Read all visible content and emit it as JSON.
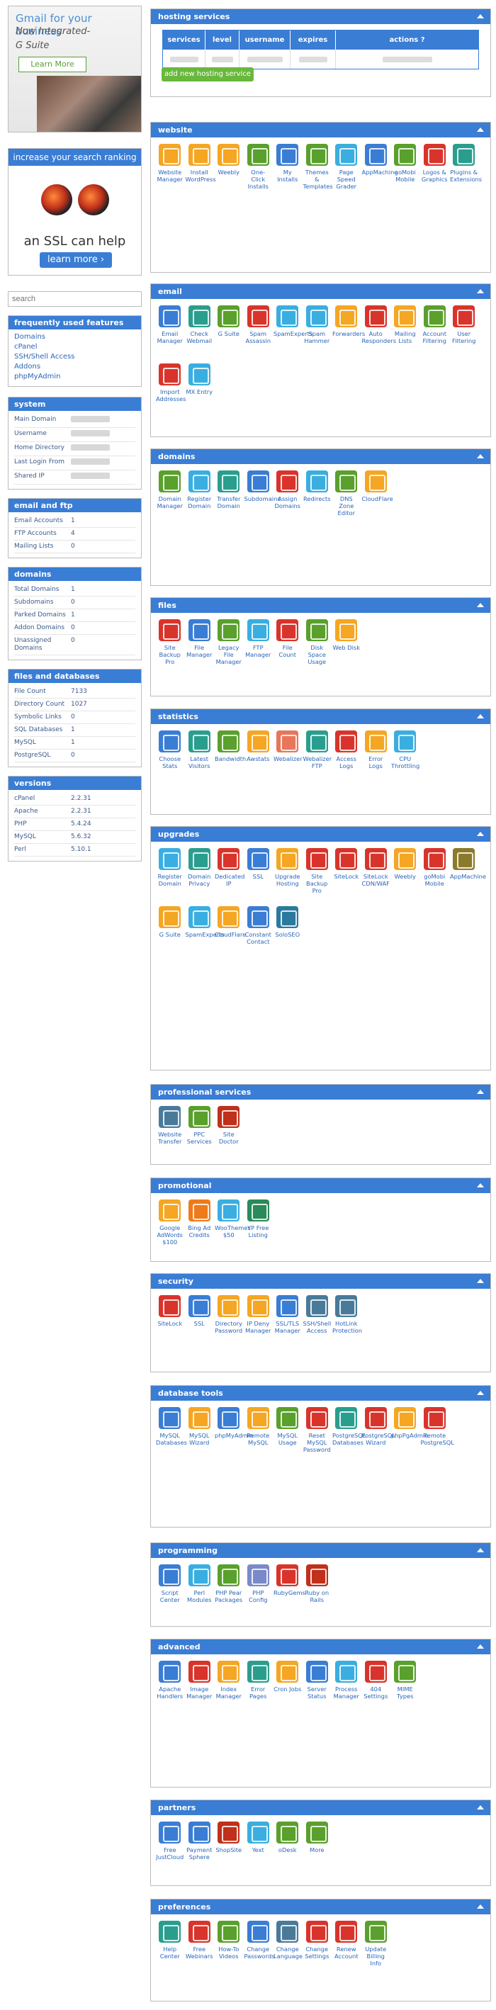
{
  "ads": {
    "gsuite": {
      "line1": "Gmail for your business",
      "line2": "Now Integrated-",
      "line3": "G Suite",
      "button": "Learn More"
    },
    "ssl": {
      "header": "increase your search ranking",
      "text": "an SSL can help",
      "button": "learn more  ›"
    }
  },
  "search_placeholder": "search",
  "features": {
    "title": "frequently used features",
    "links": [
      "Domains",
      "cPanel",
      "SSH/Shell Access",
      "Addons",
      "phpMyAdmin"
    ]
  },
  "system": {
    "title": "system",
    "rows": [
      {
        "k": "Main Domain"
      },
      {
        "k": "Username"
      },
      {
        "k": "Home Directory"
      },
      {
        "k": "Last Login From"
      },
      {
        "k": "Shared IP"
      }
    ]
  },
  "email_ftp": {
    "title": "email and ftp",
    "rows": [
      {
        "k": "Email Accounts",
        "v": "1"
      },
      {
        "k": "FTP Accounts",
        "v": "4"
      },
      {
        "k": "Mailing Lists",
        "v": "0"
      }
    ]
  },
  "domains_stats": {
    "title": "domains",
    "rows": [
      {
        "k": "Total Domains",
        "v": "1"
      },
      {
        "k": "Subdomains",
        "v": "0"
      },
      {
        "k": "Parked Domains",
        "v": "1"
      },
      {
        "k": "Addon Domains",
        "v": "0"
      },
      {
        "k": "Unassigned Domains",
        "v": "0"
      }
    ]
  },
  "files_db": {
    "title": "files and databases",
    "rows": [
      {
        "k": "File Count",
        "v": "7133"
      },
      {
        "k": "Directory Count",
        "v": "1027"
      },
      {
        "k": "Symbolic Links",
        "v": "0"
      },
      {
        "k": "SQL Databases",
        "v": "1"
      },
      {
        "k": "MySQL",
        "v": "1"
      },
      {
        "k": "PostgreSQL",
        "v": "0"
      }
    ]
  },
  "versions": {
    "title": "versions",
    "rows": [
      {
        "k": "cPanel",
        "v": "2.2.31"
      },
      {
        "k": "Apache",
        "v": "2.2.31"
      },
      {
        "k": "PHP",
        "v": "5.4.24"
      },
      {
        "k": "MySQL",
        "v": "5.6.32"
      },
      {
        "k": "Perl",
        "v": "5.10.1"
      }
    ]
  },
  "hosting": {
    "title": "hosting services",
    "columns": [
      "services",
      "level",
      "username",
      "expires",
      "actions"
    ],
    "add_button": "add new hosting service"
  },
  "sections": [
    {
      "title": "website",
      "items": [
        [
          "Website Manager",
          "#f5a623"
        ],
        [
          "Install WordPress",
          "#f5a623"
        ],
        [
          "Weebly",
          "#f5a623"
        ],
        [
          "One-Click Installs",
          "#5aa02c"
        ],
        [
          "My Installs",
          "#3a7dd4"
        ],
        [
          "Themes & Templates",
          "#5aa02c"
        ],
        [
          "Page Speed Grader",
          "#3aaee0"
        ],
        [
          "AppMachine",
          "#3a7dd4"
        ],
        [
          "goMobi Mobile",
          "#5aa02c"
        ],
        [
          "Logos & Graphics",
          "#d9342b"
        ],
        [
          "Plugins & Extensions",
          "#2a9e8e"
        ]
      ]
    },
    {
      "title": "email",
      "items": [
        [
          "Email Manager",
          "#3a7dd4"
        ],
        [
          "Check Webmail",
          "#2a9e8e"
        ],
        [
          "G Suite",
          "#5aa02c"
        ],
        [
          "Spam Assassin",
          "#d9342b"
        ],
        [
          "SpamExperts",
          "#3aaee0"
        ],
        [
          "Spam Hammer",
          "#3aaee0"
        ],
        [
          "Forwarders",
          "#f5a623"
        ],
        [
          "Auto Responders",
          "#d9342b"
        ],
        [
          "Mailing Lists",
          "#f5a623"
        ],
        [
          "Account Filtering",
          "#5aa02c"
        ],
        [
          "User Filtering",
          "#d9342b"
        ],
        [
          "Import Addresses",
          "#d9342b"
        ],
        [
          "MX Entry",
          "#3aaee0"
        ]
      ]
    },
    {
      "title": "domains",
      "items": [
        [
          "Domain Manager",
          "#5aa02c"
        ],
        [
          "Register Domain",
          "#3aaee0"
        ],
        [
          "Transfer Domain",
          "#2a9e8e"
        ],
        [
          "Subdomains",
          "#3a7dd4"
        ],
        [
          "Assign Domains",
          "#d9342b"
        ],
        [
          "Redirects",
          "#3aaee0"
        ],
        [
          "DNS Zone Editor",
          "#5aa02c"
        ],
        [
          "CloudFlare",
          "#f5a623"
        ]
      ]
    },
    {
      "title": "files",
      "items": [
        [
          "Site Backup Pro",
          "#d9342b"
        ],
        [
          "File Manager",
          "#3a7dd4"
        ],
        [
          "Legacy File Manager",
          "#5aa02c"
        ],
        [
          "FTP Manager",
          "#3aaee0"
        ],
        [
          "File Count",
          "#d9342b"
        ],
        [
          "Disk Space Usage",
          "#5aa02c"
        ],
        [
          "Web Disk",
          "#f5a623"
        ]
      ]
    },
    {
      "title": "statistics",
      "items": [
        [
          "Choose Stats",
          "#3a7dd4"
        ],
        [
          "Latest Visitors",
          "#2a9e8e"
        ],
        [
          "Bandwidth",
          "#5aa02c"
        ],
        [
          "Awstats",
          "#f5a623"
        ],
        [
          "Webalizer",
          "#e8765a"
        ],
        [
          "Webalizer FTP",
          "#2a9e8e"
        ],
        [
          "Access Logs",
          "#d9342b"
        ],
        [
          "Error Logs",
          "#f5a623"
        ],
        [
          "CPU Throttling",
          "#3aaee0"
        ]
      ]
    },
    {
      "title": "upgrades",
      "items": [
        [
          "Register Domain",
          "#3aaee0"
        ],
        [
          "Domain Privacy",
          "#2a9e8e"
        ],
        [
          "Dedicated IP",
          "#d9342b"
        ],
        [
          "SSL",
          "#3a7dd4"
        ],
        [
          "Upgrade Hosting",
          "#f5a623"
        ],
        [
          "Site Backup Pro",
          "#d9342b"
        ],
        [
          "SiteLock",
          "#d9342b"
        ],
        [
          "SiteLock CDN/WAF",
          "#d9342b"
        ],
        [
          "Weebly",
          "#f5a623"
        ],
        [
          "goMobi Mobile",
          "#d9342b"
        ],
        [
          "AppMachine",
          "#8a7a2a"
        ],
        [
          "G Suite",
          "#f5a623"
        ],
        [
          "SpamExperts",
          "#3aaee0"
        ],
        [
          "CloudFlare",
          "#f5a623"
        ],
        [
          "Constant Contact",
          "#3a7dd4"
        ],
        [
          "SoloSEO",
          "#2a7a9e"
        ]
      ]
    },
    {
      "title": "professional services",
      "items": [
        [
          "Website Transfer",
          "#4a7a9a"
        ],
        [
          "PPC Services",
          "#5aa02c"
        ],
        [
          "Site Doctor",
          "#c0301a"
        ]
      ]
    },
    {
      "title": "promotional",
      "items": [
        [
          "Google AdWords $100",
          "#f5a623"
        ],
        [
          "Bing Ad Credits",
          "#f07a1a"
        ],
        [
          "WooThemes $50",
          "#3aaee0"
        ],
        [
          "YP Free Listing",
          "#2a8a5a"
        ]
      ]
    },
    {
      "title": "security",
      "items": [
        [
          "SiteLock",
          "#d9342b"
        ],
        [
          "SSL",
          "#3a7dd4"
        ],
        [
          "Directory Password",
          "#f5a623"
        ],
        [
          "IP Deny Manager",
          "#f5a623"
        ],
        [
          "SSL/TLS Manager",
          "#3a7dd4"
        ],
        [
          "SSH/Shell Access",
          "#4a7a9a"
        ],
        [
          "HotLink Protection",
          "#4a7a9a"
        ]
      ]
    },
    {
      "title": "database tools",
      "items": [
        [
          "MySQL Databases",
          "#3a7dd4"
        ],
        [
          "MySQL Wizard",
          "#f5a623"
        ],
        [
          "phpMyAdmin",
          "#3a7dd4"
        ],
        [
          "Remote MySQL",
          "#f5a623"
        ],
        [
          "MySQL Usage",
          "#5aa02c"
        ],
        [
          "Reset MySQL Password",
          "#d9342b"
        ],
        [
          "PostgreSQL Databases",
          "#2a9e8e"
        ],
        [
          "PostgreSQL Wizard",
          "#d9342b"
        ],
        [
          "phpPgAdmin",
          "#f5a623"
        ],
        [
          "Remote PostgreSQL",
          "#d9342b"
        ]
      ]
    },
    {
      "title": "programming",
      "items": [
        [
          "Script Center",
          "#3a7dd4"
        ],
        [
          "Perl Modules",
          "#3aaee0"
        ],
        [
          "PHP Pear Packages",
          "#5aa02c"
        ],
        [
          "PHP Config",
          "#7a8ac8"
        ],
        [
          "RubyGems",
          "#d9342b"
        ],
        [
          "Ruby on Rails",
          "#c0301a"
        ]
      ]
    },
    {
      "title": "advanced",
      "items": [
        [
          "Apache Handlers",
          "#3a7dd4"
        ],
        [
          "Image Manager",
          "#d9342b"
        ],
        [
          "Index Manager",
          "#f5a623"
        ],
        [
          "Error Pages",
          "#2a9e8e"
        ],
        [
          "Cron Jobs",
          "#f5a623"
        ],
        [
          "Server Status",
          "#3a7dd4"
        ],
        [
          "Process Manager",
          "#3aaee0"
        ],
        [
          "404 Settings",
          "#d9342b"
        ],
        [
          "MIME Types",
          "#5aa02c"
        ]
      ]
    },
    {
      "title": "partners",
      "items": [
        [
          "Free JustCloud",
          "#3a7dd4"
        ],
        [
          "Payment Sphere",
          "#3a7dd4"
        ],
        [
          "ShopSite",
          "#c0301a"
        ],
        [
          "Yext",
          "#3aaee0"
        ],
        [
          "oDesk",
          "#5aa02c"
        ],
        [
          "More",
          "#5aa02c"
        ]
      ]
    },
    {
      "title": "preferences",
      "items": [
        [
          "Help Center",
          "#2a9e8e"
        ],
        [
          "Free Webinars",
          "#d9342b"
        ],
        [
          "How-To Videos",
          "#5aa02c"
        ],
        [
          "Change Passwords",
          "#3a7dd4"
        ],
        [
          "Change Language",
          "#4a7a9a"
        ],
        [
          "Change Settings",
          "#d9342b"
        ],
        [
          "Renew Account",
          "#d9342b"
        ],
        [
          "Update Billing Info",
          "#5aa02c"
        ]
      ]
    }
  ]
}
